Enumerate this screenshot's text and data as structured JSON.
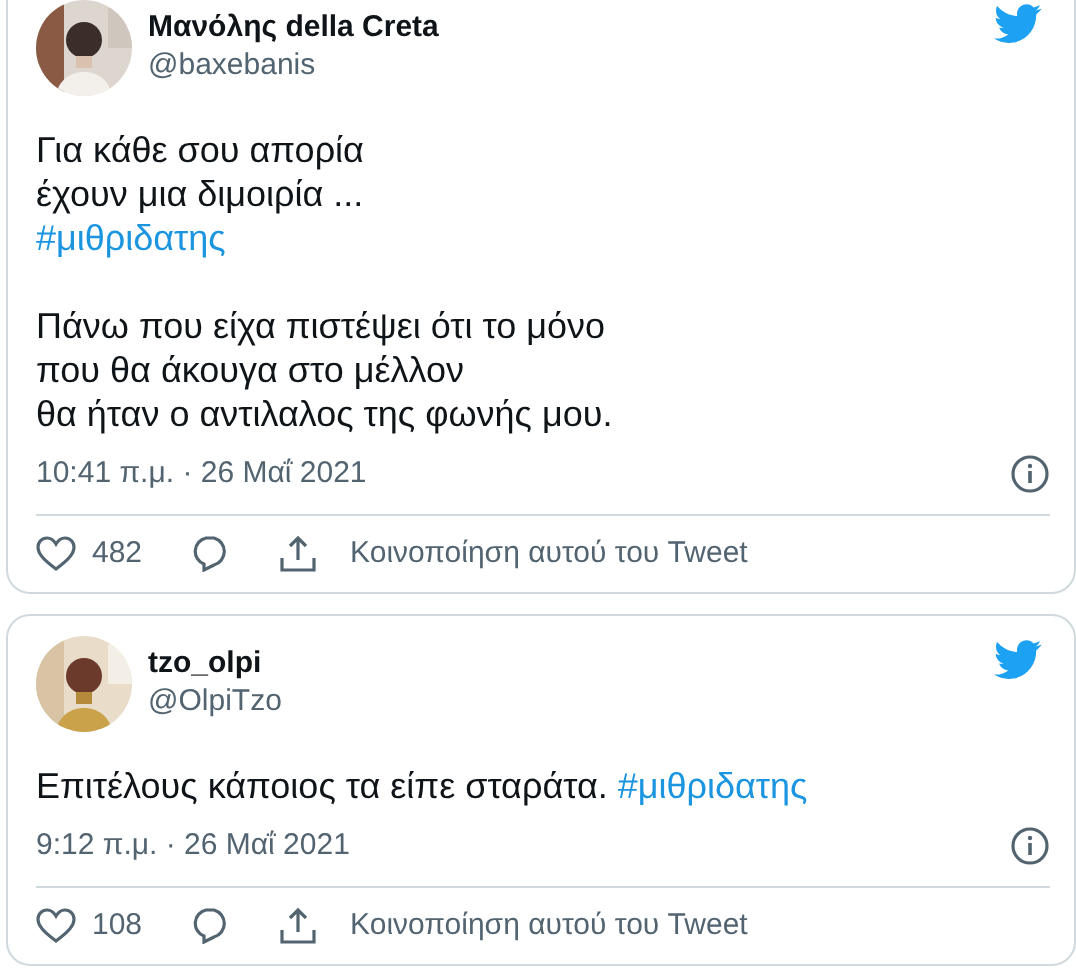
{
  "tweets": [
    {
      "name": "Μανόλης della Creta",
      "handle": "@baxebanis",
      "top_cut": true,
      "paragraphs": [
        [
          [
            {
              "kind": "text",
              "text": "Για κάθε σου απορία"
            }
          ],
          [
            {
              "kind": "text",
              "text": "έχουν μια διμοιρία ..."
            }
          ],
          [
            {
              "kind": "hashtag",
              "text": "#μιθριδατης"
            }
          ]
        ],
        [
          [
            {
              "kind": "text",
              "text": "Πάνω που είχα πιστέψει ότι το μόνο"
            }
          ],
          [
            {
              "kind": "text",
              "text": "που θα άκουγα στο μέλλον"
            }
          ],
          [
            {
              "kind": "text",
              "text": "θα ήταν ο αντιλαλος της φωνής μου."
            }
          ]
        ]
      ],
      "time": "10:41 π.μ. · 26 Μαΐ 2021",
      "likes": "482",
      "share": "Κοινοποίηση αυτού του Tweet"
    },
    {
      "name": "tzo_olpi",
      "handle": "@OlpiTzo",
      "top_cut": false,
      "paragraphs": [
        [
          [
            {
              "kind": "text",
              "text": "Επιτέλους κάποιος τα είπε σταράτα. "
            },
            {
              "kind": "hashtag",
              "text": "#μιθριδατης"
            }
          ]
        ]
      ],
      "time": "9:12 π.μ. · 26 Μαΐ 2021",
      "likes": "108",
      "share": "Κοινοποίηση αυτού του Tweet"
    }
  ]
}
